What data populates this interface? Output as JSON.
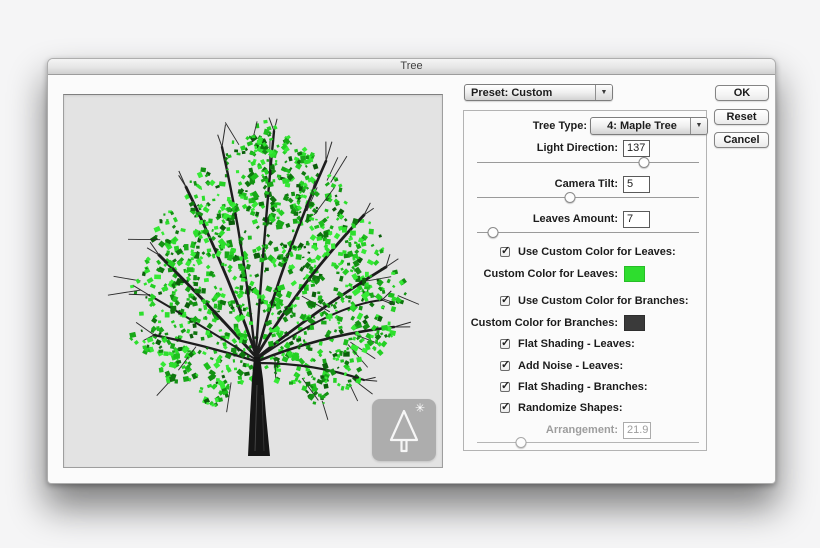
{
  "window": {
    "title": "Tree"
  },
  "icons": {
    "checkmark": "✓",
    "dropdown_arrow": "▼",
    "sun": "✳"
  },
  "preset_dropdown": {
    "value": "Preset: Custom"
  },
  "action_buttons": {
    "ok": "OK",
    "reset": "Reset",
    "cancel": "Cancel"
  },
  "panel": {
    "tree_type": {
      "label": "Tree Type:",
      "value": "4: Maple Tree"
    },
    "light_direction": {
      "label": "Light Direction:",
      "value": "137",
      "slider_percent": 75
    },
    "camera_tilt": {
      "label": "Camera Tilt:",
      "value": "5",
      "slider_percent": 42
    },
    "leaves_amount": {
      "label": "Leaves Amount:",
      "value": "7",
      "slider_percent": 7
    },
    "use_custom_color_leaves": {
      "label": "Use Custom Color for Leaves:",
      "checked": true
    },
    "custom_color_leaves": {
      "label": "Custom Color for Leaves:",
      "color": "#2edd2e"
    },
    "use_custom_color_branches": {
      "label": "Use Custom Color for Branches:",
      "checked": true
    },
    "custom_color_branches": {
      "label": "Custom Color for Branches:",
      "color": "#3a3a3a"
    },
    "flat_shading_leaves": {
      "label": "Flat Shading - Leaves:",
      "checked": true
    },
    "add_noise_leaves": {
      "label": "Add Noise - Leaves:",
      "checked": true
    },
    "flat_shading_branches": {
      "label": "Flat Shading - Branches:",
      "checked": true
    },
    "randomize_shapes": {
      "label": "Randomize Shapes:",
      "checked": true
    },
    "arrangement": {
      "label": "Arrangement:",
      "value": "21.9",
      "slider_percent": 20,
      "disabled": true
    }
  }
}
